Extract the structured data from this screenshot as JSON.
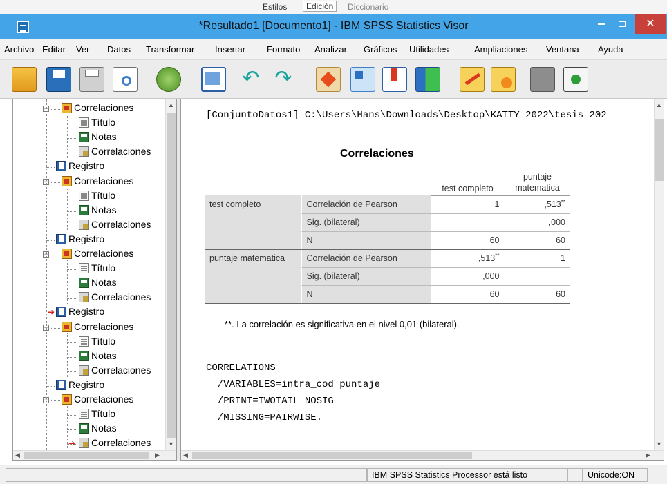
{
  "background_strip": {
    "items": [
      "Estilos",
      "Edición",
      "Diccionario"
    ]
  },
  "window": {
    "title": "*Resultado1 [Documento1] - IBM SPSS Statistics Visor"
  },
  "menubar": {
    "items": [
      "Archivo",
      "Editar",
      "Ver",
      "Datos",
      "Transformar",
      "Insertar",
      "Formato",
      "Analizar",
      "Gráficos",
      "Utilidades",
      "Ampliaciones",
      "Ventana",
      "Ayuda"
    ]
  },
  "toolbar": {
    "icons": [
      "open-folder-icon",
      "save-icon",
      "print-icon",
      "print-preview-icon",
      "export-icon",
      "dialog-recall-icon",
      "undo-icon",
      "redo-icon",
      "goto-data-icon",
      "goto-case-icon",
      "insert-variable-icon",
      "select-cases-icon",
      "designate-window-icon",
      "script-icon",
      "pivot-icon",
      "add-output-icon"
    ]
  },
  "outline": {
    "nodes": [
      {
        "label": "Correlaciones",
        "kind": "corr"
      },
      {
        "label": "Título",
        "kind": "title"
      },
      {
        "label": "Notas",
        "kind": "note"
      },
      {
        "label": "Correlaciones",
        "kind": "corr2"
      },
      {
        "label": "Registro",
        "kind": "reg"
      },
      {
        "label": "Correlaciones",
        "kind": "corr"
      },
      {
        "label": "Título",
        "kind": "title"
      },
      {
        "label": "Notas",
        "kind": "note"
      },
      {
        "label": "Correlaciones",
        "kind": "corr2"
      },
      {
        "label": "Registro",
        "kind": "reg"
      },
      {
        "label": "Correlaciones",
        "kind": "corr"
      },
      {
        "label": "Título",
        "kind": "title"
      },
      {
        "label": "Notas",
        "kind": "note"
      },
      {
        "label": "Correlaciones",
        "kind": "corr2"
      },
      {
        "label": "Registro",
        "kind": "reg"
      },
      {
        "label": "Correlaciones",
        "kind": "corr"
      },
      {
        "label": "Título",
        "kind": "title"
      },
      {
        "label": "Notas",
        "kind": "note"
      },
      {
        "label": "Correlaciones",
        "kind": "corr2"
      },
      {
        "label": "Registro",
        "kind": "reg"
      },
      {
        "label": "Correlaciones",
        "kind": "corr"
      },
      {
        "label": "Título",
        "kind": "title"
      },
      {
        "label": "Notas",
        "kind": "note"
      },
      {
        "label": "Correlaciones",
        "kind": "corr2"
      }
    ]
  },
  "output": {
    "dataset_line": "[ConjuntoDatos1] C:\\Users\\Hans\\Downloads\\Desktop\\KATTY 2022\\tesis 202",
    "table_title": "Correlaciones",
    "col_headers": [
      "test completo",
      "puntaje\nmatematica"
    ],
    "rows": [
      {
        "var": "test completo",
        "stat": "Correlación de Pearson",
        "c1": "1",
        "c2": ",513",
        "c2_mark": "**"
      },
      {
        "var": "",
        "stat": "Sig. (bilateral)",
        "c1": "",
        "c2": ",000"
      },
      {
        "var": "",
        "stat": "N",
        "c1": "60",
        "c2": "60"
      },
      {
        "var": "puntaje matematica",
        "stat": "Correlación de Pearson",
        "c1": ",513",
        "c1_mark": "**",
        "c2": "1"
      },
      {
        "var": "",
        "stat": "Sig. (bilateral)",
        "c1": ",000",
        "c2": ""
      },
      {
        "var": "",
        "stat": "N",
        "c1": "60",
        "c2": "60"
      }
    ],
    "footnote": "**. La correlación es significativa en el nivel 0,01 (bilateral).",
    "syntax": [
      "CORRELATIONS",
      "  /VARIABLES=intra_cod puntaje",
      "  /PRINT=TWOTAIL NOSIG",
      "  /MISSING=PAIRWISE."
    ]
  },
  "statusbar": {
    "processor": "IBM SPSS Statistics Processor está listo",
    "unicode": "Unicode:ON"
  },
  "colors": {
    "titlebar": "#43a5e8",
    "close_button": "#c8403a",
    "table_label_bg": "#e0e0e0"
  }
}
